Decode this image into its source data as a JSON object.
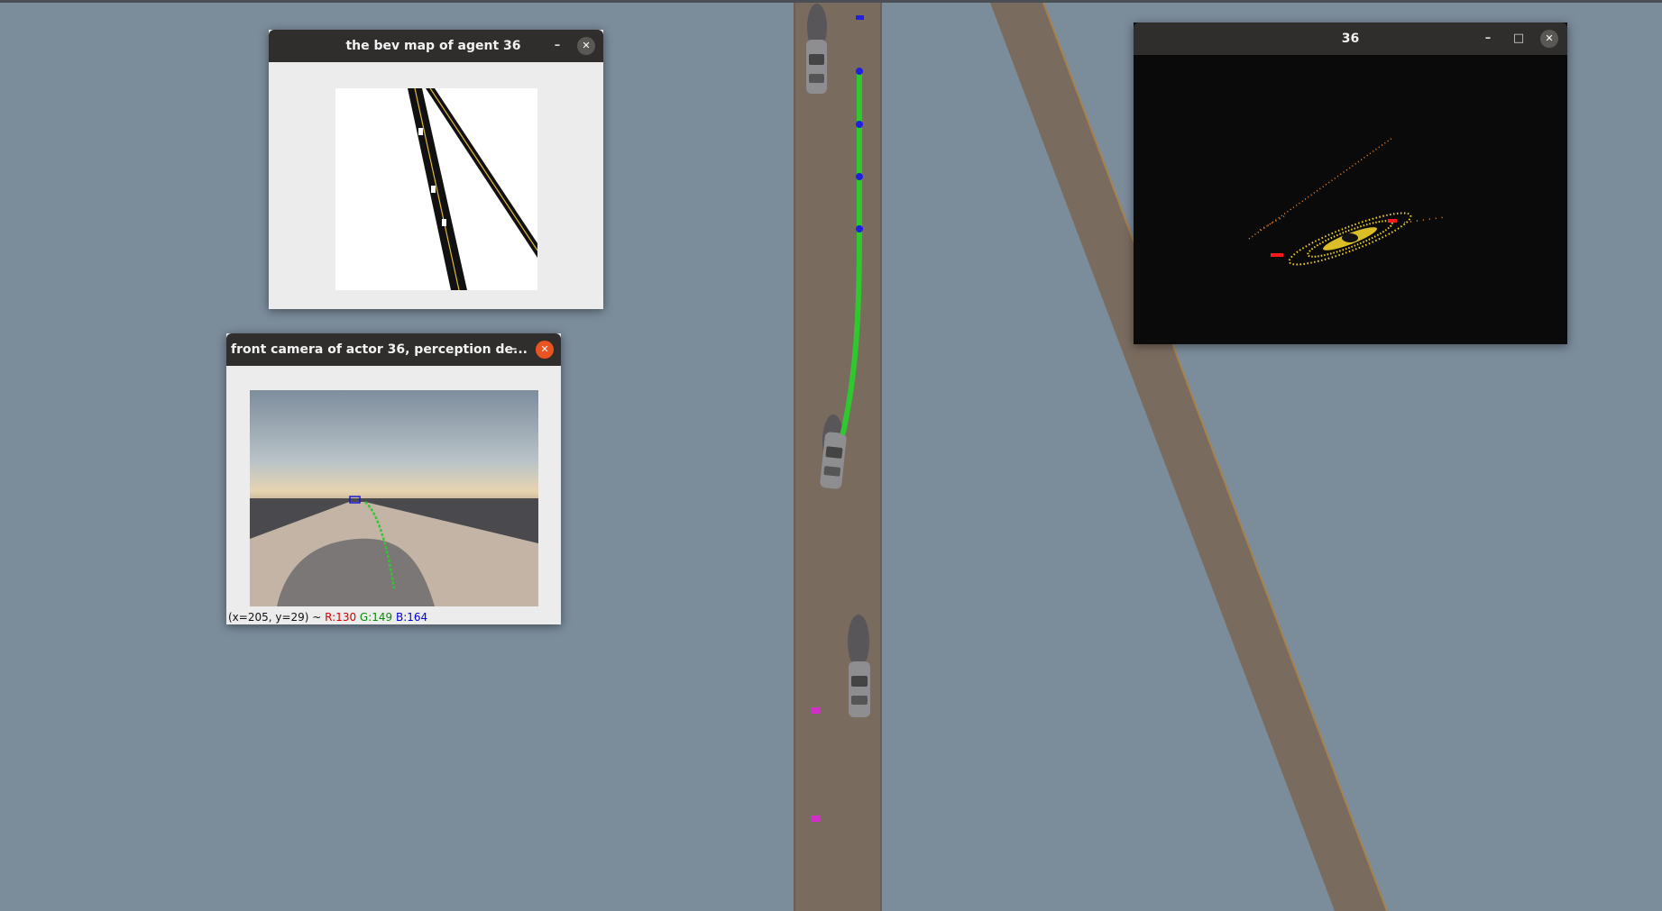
{
  "windows": {
    "bev": {
      "title": "the bev map of agent 36",
      "minimize": "–",
      "close": "✕"
    },
    "camera": {
      "title": "front camera of actor 36, perception de...",
      "minimize": "–",
      "close": "✕",
      "status": {
        "coords": "(x=205, y=29) ~ ",
        "r": "R:130",
        "g": "G:149",
        "b": "B:164"
      }
    },
    "lidar": {
      "title": "36",
      "minimize": "–",
      "maximize": "□",
      "close": "✕"
    }
  },
  "colors": {
    "sky": "#7b8c9b",
    "road": "#7a6b5f",
    "road_edge": "#a7824e",
    "trajectory": "#2ec92e",
    "waypoint": "#2020e0",
    "marker": "#d02fc8",
    "titlebar": "#302e2c",
    "close_active": "#e95420",
    "lidar_points": "#f2d22a",
    "lidar_far": "#ff8c2a",
    "lidar_red": "#ff1a1a"
  }
}
